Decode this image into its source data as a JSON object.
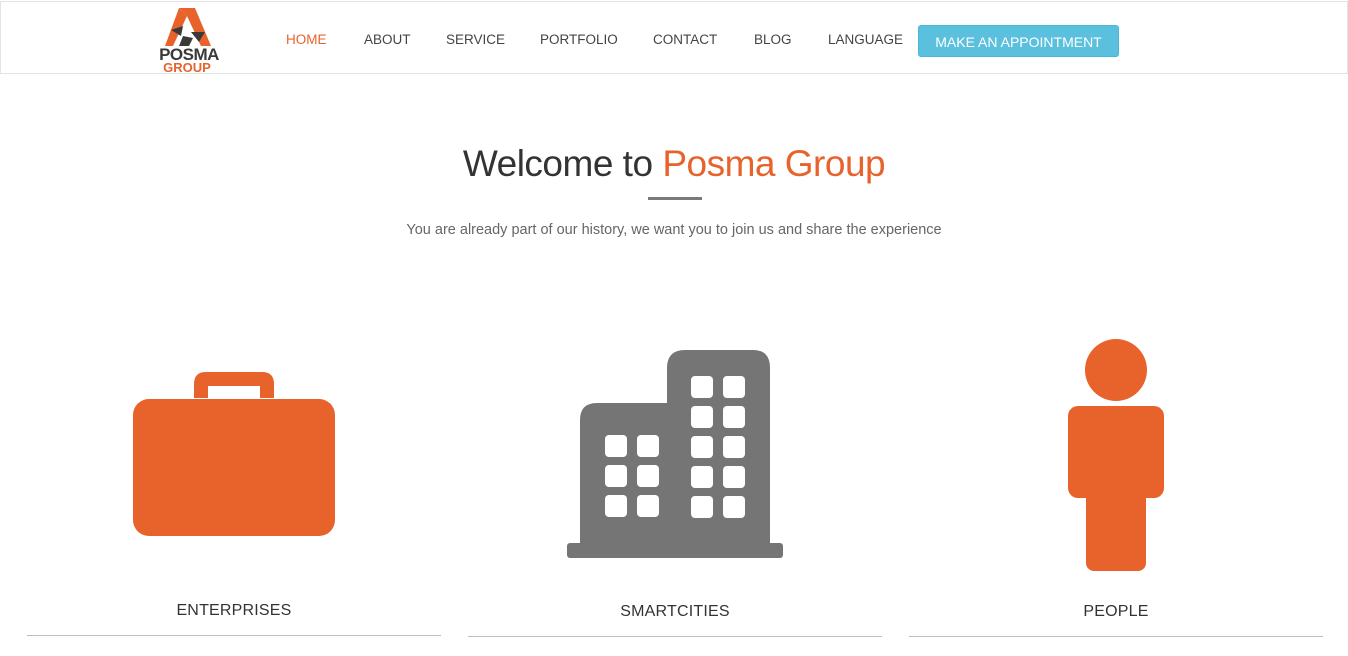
{
  "brand": {
    "name": "POSMA",
    "sub": "GROUP",
    "accent_color": "#e8622c",
    "dark_color": "#3a3a3a"
  },
  "nav": {
    "items": [
      {
        "label": "HOME",
        "active": true
      },
      {
        "label": "ABOUT",
        "active": false
      },
      {
        "label": "SERVICE",
        "active": false
      },
      {
        "label": "PORTFOLIO",
        "active": false
      },
      {
        "label": "CONTACT",
        "active": false
      },
      {
        "label": "BLOG",
        "active": false
      },
      {
        "label": "LANGUAGE",
        "active": false
      }
    ],
    "cta_label": "MAKE AN APPOINTMENT",
    "cta_color": "#5bc0de"
  },
  "hero": {
    "title_prefix": "Welcome to ",
    "title_accent": "Posma Group",
    "subtitle": "You are already part of our history, we want you to join us and share the experience"
  },
  "features": [
    {
      "label": "ENTERPRISES",
      "icon": "briefcase-icon",
      "color": "#e8622c"
    },
    {
      "label": "SMARTCITIES",
      "icon": "building-icon",
      "color": "#757575"
    },
    {
      "label": "PEOPLE",
      "icon": "person-icon",
      "color": "#e8622c"
    }
  ]
}
